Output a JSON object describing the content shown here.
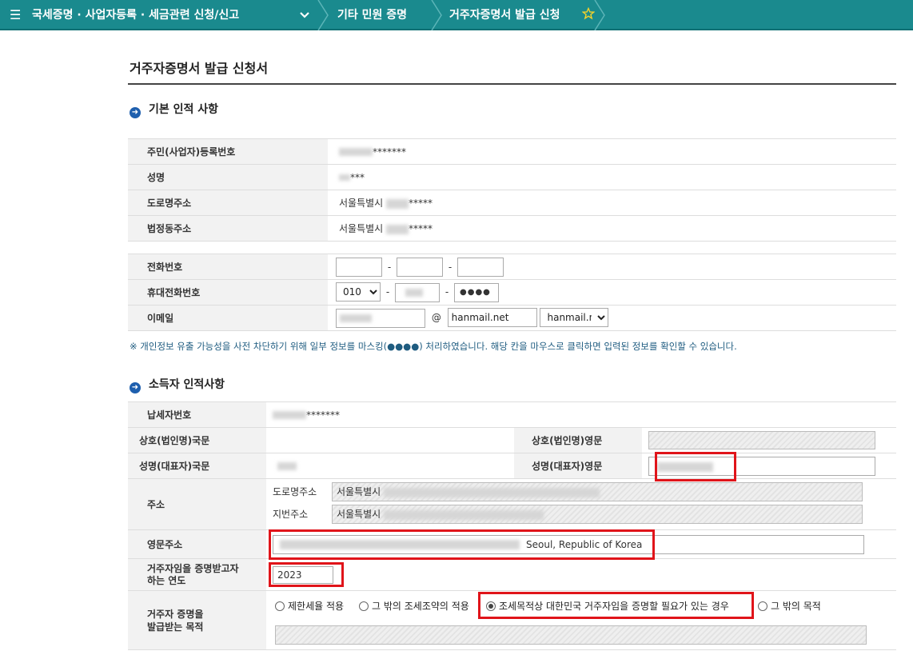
{
  "nav": {
    "crumb1": "국세증명 · 사업자등록 · 세금관련 신청/신고",
    "crumb2": "기타 민원 증명",
    "crumb3": "거주자증명서 발급 신청"
  },
  "page_title": "거주자증명서 발급 신청서",
  "basic": {
    "section_title": "기본 인적 사항",
    "labels": {
      "reg_no": "주민(사업자)등록번호",
      "name": "성명",
      "road_addr": "도로명주소",
      "legal_addr": "법정동주소",
      "phone": "전화번호",
      "mobile": "휴대전화번호",
      "email": "이메일"
    },
    "values": {
      "reg_no_mask": "*******",
      "name_mask": "***",
      "road_addr_prefix": "서울특별시",
      "road_addr_mask": "*****",
      "legal_addr_prefix": "서울특별시",
      "legal_addr_mask": "*****"
    },
    "mobile_prefix": "010",
    "mobile_last": "●●●●",
    "email_at": "@",
    "email_domain": "hanmail.net",
    "email_domain_select": "hanmail.net",
    "dash": "-"
  },
  "notice": "※ 개인정보 유출 가능성을 사전 차단하기 위해 일부 정보를 마스킹(●●●●) 처리하였습니다. 해당 칸을 마우스로 클릭하면 입력된 정보를 확인할 수 있습니다.",
  "income": {
    "section_title": "소득자 인적사항",
    "labels": {
      "tax_no": "납세자번호",
      "trade_kr": "상호(법인명)국문",
      "trade_en": "상호(법인명)영문",
      "rep_kr": "성명(대표자)국문",
      "rep_en": "성명(대표자)영문",
      "address": "주소",
      "road_addr": "도로명주소",
      "lot_addr": "지번주소",
      "eng_addr": "영문주소",
      "year_l1": "거주자임을 증명받고자",
      "year_l2": "하는 연도",
      "purpose_l1": "거주자 증명을",
      "purpose_l2": "발급받는 목적"
    },
    "values": {
      "tax_no_mask": "*******",
      "road_addr_prefix": "서울특별시",
      "lot_addr_prefix": "서울특별시",
      "eng_addr_suffix": "Seoul, Republic of Korea",
      "year": "2023"
    },
    "purposes": [
      "제한세율 적용",
      "그 밖의 조세조약의 적용",
      "조세목적상 대한민국 거주자임을 증명할 필요가 있는 경우",
      "그 밖의 목적"
    ],
    "selected_purpose": "조세목적상 대한민국 거주자임을 증명할 필요가 있는 경우"
  }
}
